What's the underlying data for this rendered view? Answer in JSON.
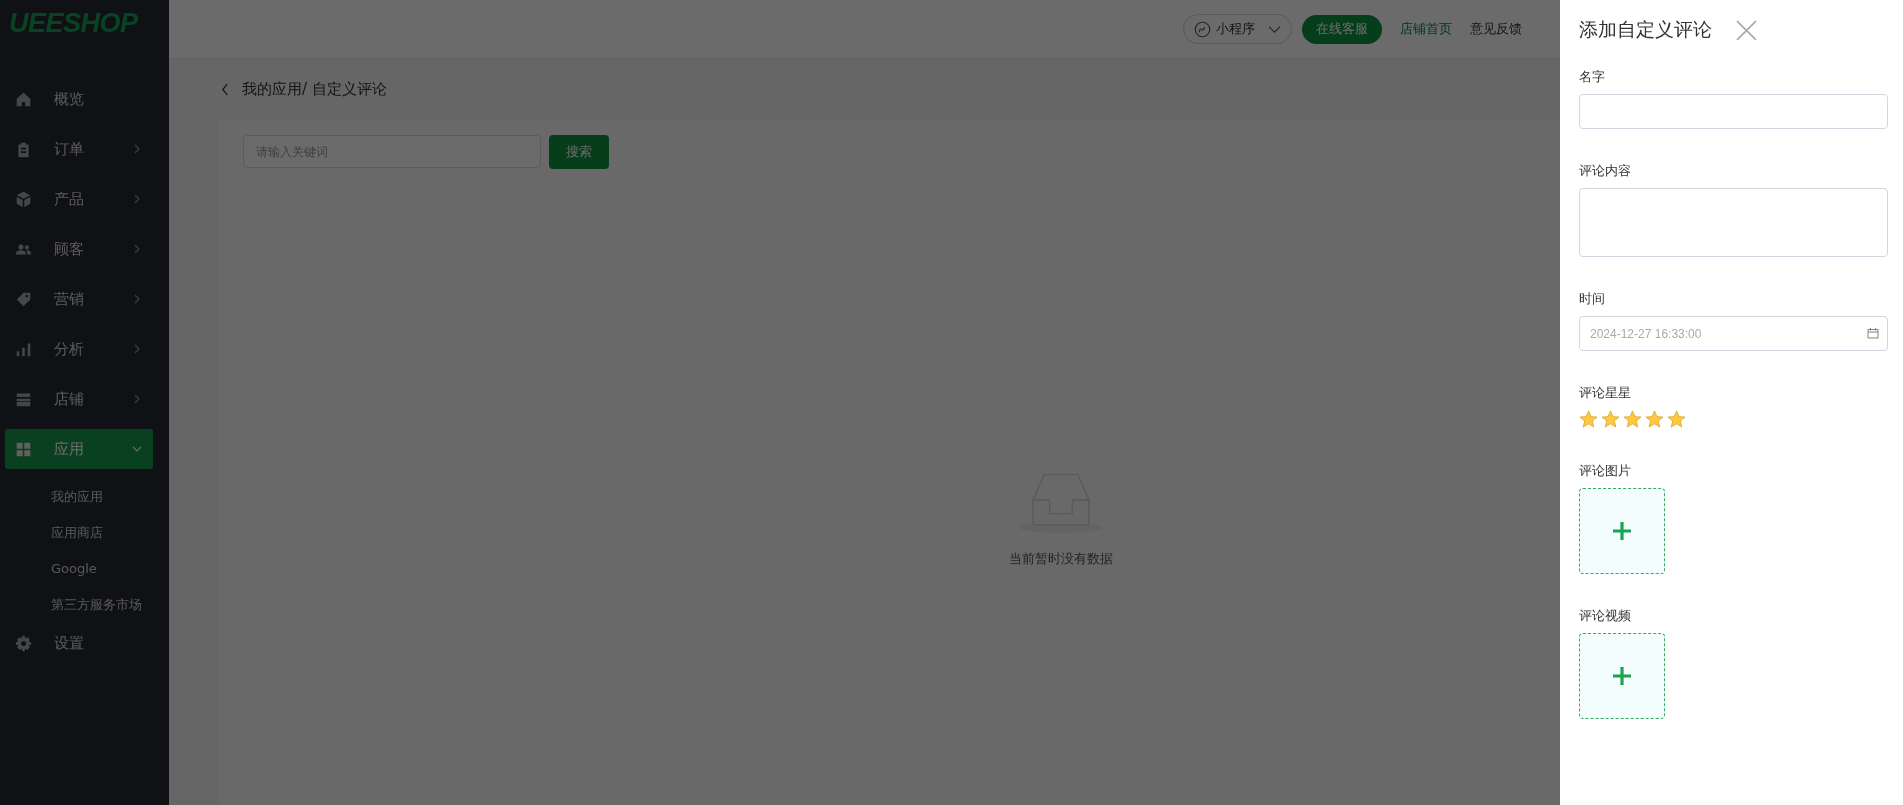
{
  "logo": "UEESHOP",
  "sidebar": {
    "items": [
      {
        "label": "概览",
        "kind": "link",
        "selected": false
      },
      {
        "label": "订单",
        "kind": "menu",
        "expanded": false,
        "selected": false
      },
      {
        "label": "产品",
        "kind": "menu",
        "expanded": false,
        "selected": false
      },
      {
        "label": "顾客",
        "kind": "menu",
        "expanded": false,
        "selected": false
      },
      {
        "label": "营销",
        "kind": "menu",
        "expanded": false,
        "selected": false
      },
      {
        "label": "分析",
        "kind": "menu",
        "expanded": false,
        "selected": false
      },
      {
        "label": "店铺",
        "kind": "menu",
        "expanded": false,
        "selected": false
      },
      {
        "label": "应用",
        "kind": "menu",
        "expanded": true,
        "selected": true,
        "children": [
          {
            "label": "我的应用"
          },
          {
            "label": "应用商店"
          },
          {
            "label": "Google"
          },
          {
            "label": "第三方服务市场"
          }
        ]
      },
      {
        "label": "设置",
        "kind": "link",
        "selected": false
      }
    ]
  },
  "topbar": {
    "mini_program": "小程序",
    "service_button": "在线客服",
    "links": [
      {
        "label": "店铺首页",
        "kind": "primary"
      },
      {
        "label": "意见反馈",
        "kind": "plain"
      }
    ]
  },
  "breadcrumb": "我的应用/ 自定义评论",
  "search": {
    "placeholder": "请输入关键词",
    "button": "搜索"
  },
  "empty_text": "当前暂时没有数据",
  "drawer": {
    "title": "添加自定义评论",
    "fields": [
      {
        "kind": "text",
        "label": "名字"
      },
      {
        "kind": "textarea",
        "label": "评论内容"
      },
      {
        "kind": "date",
        "label": "时间",
        "placeholder": "2024-12-27 16:33:00"
      },
      {
        "kind": "stars",
        "label": "评论星星",
        "stars": 5
      },
      {
        "kind": "upload",
        "label": "评论图片"
      },
      {
        "kind": "upload",
        "label": "评论视频"
      }
    ]
  }
}
